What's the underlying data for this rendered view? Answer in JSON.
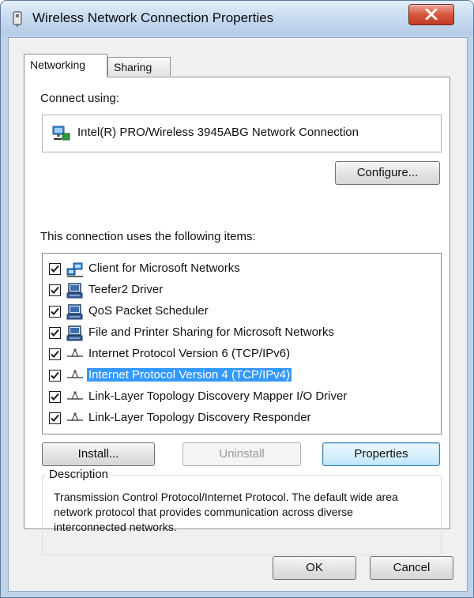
{
  "window": {
    "title": "Wireless Network Connection Properties",
    "close_label": "X"
  },
  "tabs": [
    {
      "label": "Networking",
      "active": true
    },
    {
      "label": "Sharing",
      "active": false
    }
  ],
  "connect_using": {
    "label": "Connect using:",
    "adapter": "Intel(R) PRO/Wireless 3945ABG Network Connection",
    "configure_label": "Configure..."
  },
  "items_section": {
    "label": "This connection uses the following items:",
    "items": [
      {
        "label": "Client for Microsoft Networks",
        "checked": true,
        "icon": "client-network-icon",
        "selected": false
      },
      {
        "label": "Teefer2 Driver",
        "checked": true,
        "icon": "computer-driver-icon",
        "selected": false
      },
      {
        "label": "QoS Packet Scheduler",
        "checked": true,
        "icon": "computer-driver-icon",
        "selected": false
      },
      {
        "label": "File and Printer Sharing for Microsoft Networks",
        "checked": true,
        "icon": "computer-driver-icon",
        "selected": false
      },
      {
        "label": "Internet Protocol Version 6 (TCP/IPv6)",
        "checked": true,
        "icon": "protocol-icon",
        "selected": false
      },
      {
        "label": "Internet Protocol Version 4 (TCP/IPv4)",
        "checked": true,
        "icon": "protocol-icon",
        "selected": true
      },
      {
        "label": "Link-Layer Topology Discovery Mapper I/O Driver",
        "checked": true,
        "icon": "protocol-icon",
        "selected": false
      },
      {
        "label": "Link-Layer Topology Discovery Responder",
        "checked": true,
        "icon": "protocol-icon",
        "selected": false
      }
    ]
  },
  "buttons": {
    "install": "Install...",
    "uninstall": "Uninstall",
    "properties": "Properties",
    "ok": "OK",
    "cancel": "Cancel"
  },
  "description": {
    "title": "Description",
    "text": "Transmission Control Protocol/Internet Protocol. The default wide area network protocol that provides communication across diverse interconnected networks."
  },
  "colors": {
    "selection": "#3399ff",
    "close_button": "#c9442c",
    "title_bar": "#c3d7ee"
  }
}
